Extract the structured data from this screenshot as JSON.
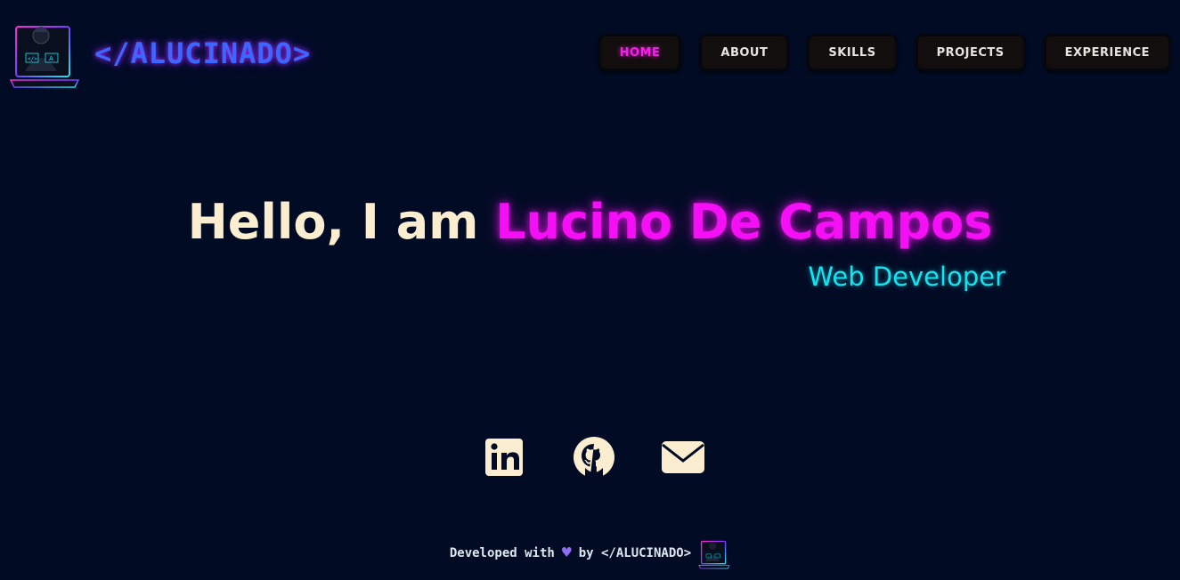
{
  "brand": {
    "logo_icon": "hacker-laptop-logo",
    "name": "</ALUCINADO>"
  },
  "nav": {
    "items": [
      {
        "label": "HOME",
        "active": true
      },
      {
        "label": "ABOUT",
        "active": false
      },
      {
        "label": "SKILLS",
        "active": false
      },
      {
        "label": "PROJECTS",
        "active": false
      },
      {
        "label": "EXPERIENCE",
        "active": false
      }
    ]
  },
  "hero": {
    "greeting": "Hello, I am ",
    "name": "Lucino De Campos",
    "role": "Web Developer"
  },
  "social": {
    "items": [
      {
        "icon": "linkedin-icon"
      },
      {
        "icon": "github-icon"
      },
      {
        "icon": "mail-icon"
      }
    ]
  },
  "footer": {
    "prefix": "Developed with",
    "heart": "♥",
    "by": "by </ALUCINADO>",
    "logo_icon": "hacker-laptop-logo"
  },
  "colors": {
    "background": "#020b24",
    "accent_pink": "#f40ff5",
    "accent_cyan": "#14e4f2",
    "brand_blue": "#3d66ff",
    "text_cream": "#fbedd0"
  }
}
